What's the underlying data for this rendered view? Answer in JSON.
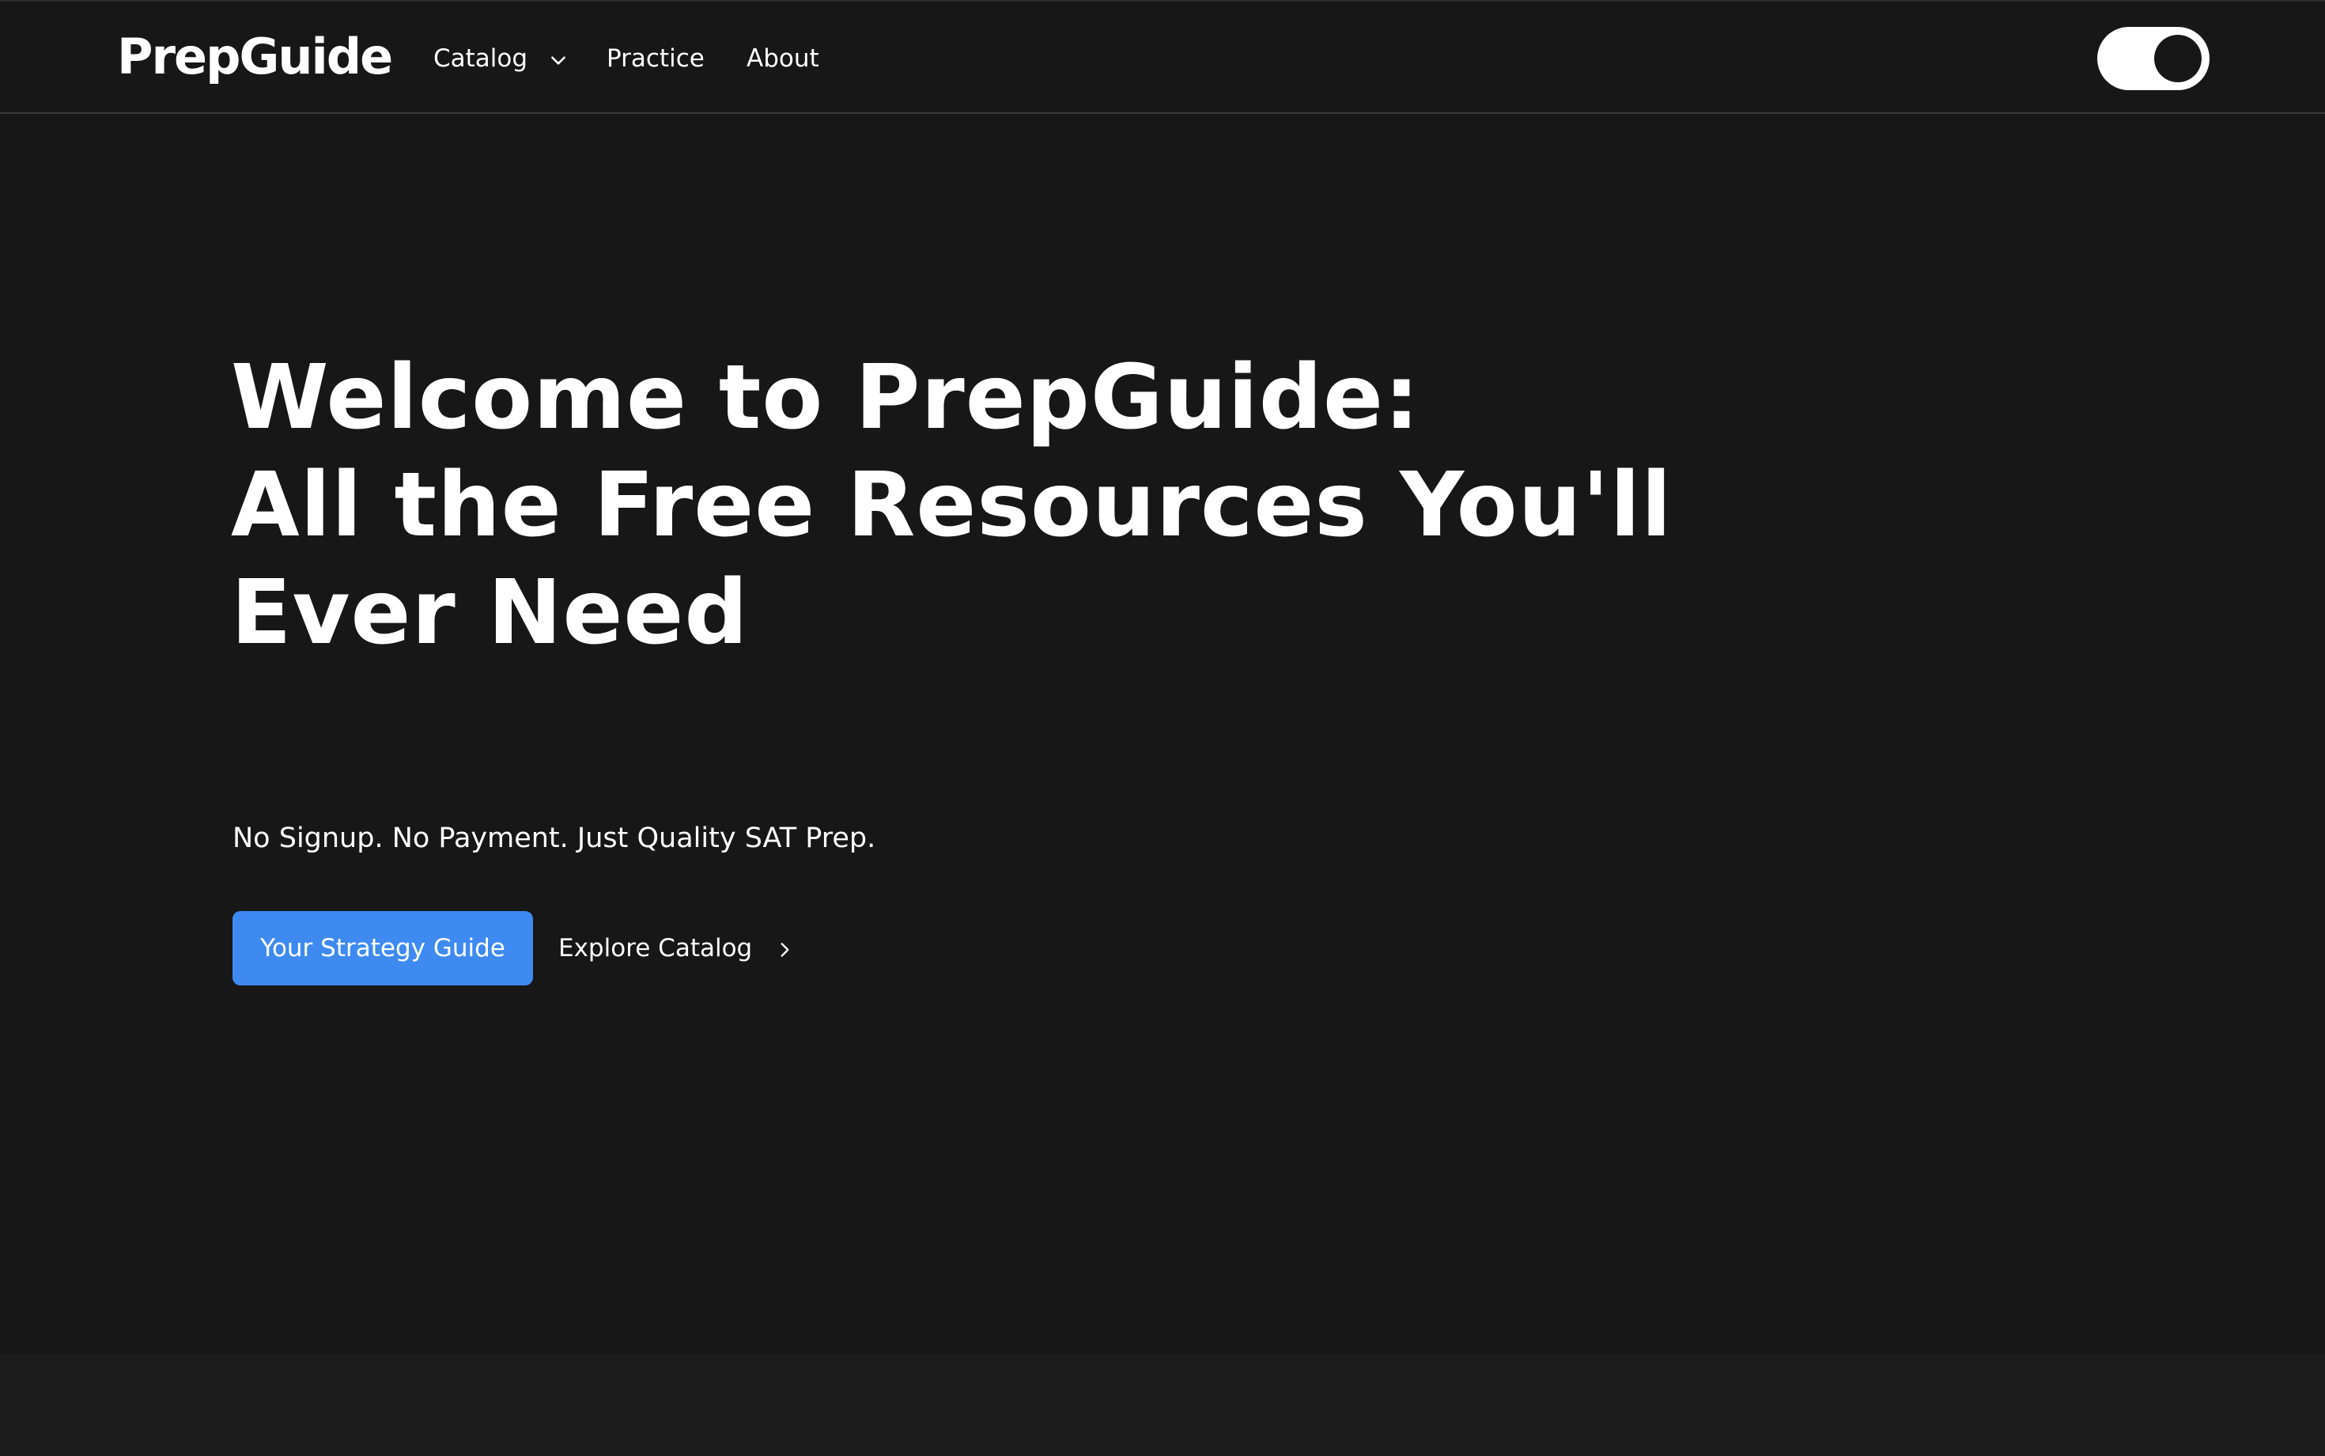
{
  "header": {
    "logo": "PrepGuide",
    "nav": {
      "catalog": "Catalog",
      "practice": "Practice",
      "about": "About"
    },
    "theme_toggle": {
      "state": "dark",
      "icon": "toggle-switch"
    }
  },
  "hero": {
    "title_lines": [
      "Welcome to PrepGuide:",
      "All the Free Resources You'll",
      "Ever Need"
    ],
    "subtitle": "No Signup. No Payment. Just Quality SAT Prep.",
    "primary_button": "Your Strategy Guide",
    "secondary_link": "Explore Catalog"
  },
  "colors": {
    "background": "#171717",
    "accent": "#3e8af1",
    "text": "#ffffff"
  }
}
